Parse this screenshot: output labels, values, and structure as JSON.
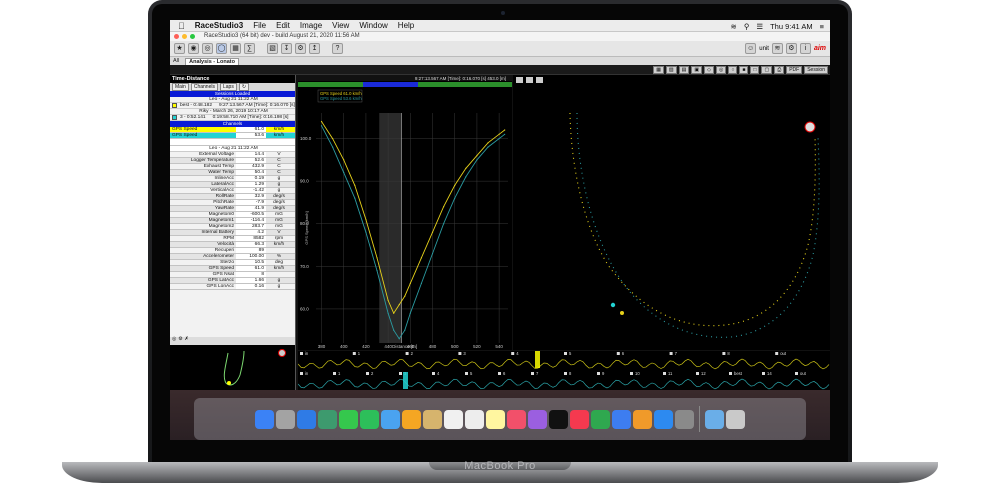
{
  "device": {
    "brand": "MacBook Pro"
  },
  "menubar": {
    "apple": "",
    "items": [
      "RaceStudio3",
      "File",
      "Edit",
      "Image",
      "View",
      "Window",
      "Help"
    ],
    "clock": "Thu 9:41 AM"
  },
  "titlebar": {
    "text": "RaceStudio3 (64 bit) dev - build August 21, 2020 11:56 AM"
  },
  "toolbar": {
    "unit_label": "unit"
  },
  "tabs": {
    "all": "All",
    "analysis": "Analysis - Lonato"
  },
  "viewbar": {
    "pdf": "PDF",
    "session": "Session"
  },
  "left_panel": {
    "title": "Time-Distance",
    "tabs": [
      "Main",
      "Channels",
      "Laps"
    ],
    "sessions_header": "Sessions Loaded",
    "sessions": [
      {
        "label": "Leo - Aug 21 11:22 AM",
        "color": "#ffffff"
      },
      {
        "label": "best - 0:48.182",
        "time": "9:27:13.567 AM [Time]: 0:16.070 [s]",
        "color": "#ffff00"
      },
      {
        "label": "Riky - March 26, 2019 10:17 AM",
        "color": "#ffffff"
      },
      {
        "label": "3 - 0:52.141",
        "time": "0:19:58.710 AM [Time]: 0:16.198 [s]",
        "color": "#22d3d3"
      }
    ],
    "channels_header": "Channels",
    "channels": [
      {
        "name": "GPS Speed",
        "value": "61.0",
        "unit": "km/h",
        "color": "#ffff00"
      },
      {
        "name": "GPS Speed",
        "value": "53.6",
        "unit": "km/h",
        "color": "#22d3d3"
      }
    ],
    "detail_title": "Leo - Aug 21 11:22 AM",
    "rows": [
      {
        "n": "External Voltage",
        "v": "14.4",
        "u": "V"
      },
      {
        "n": "Logger Temperature",
        "v": "52.6",
        "u": "C"
      },
      {
        "n": "Exhaust Temp",
        "v": "432.9",
        "u": "C"
      },
      {
        "n": "Water Temp",
        "v": "50.4",
        "u": "C"
      },
      {
        "n": "InlineAcc",
        "v": "0.19",
        "u": "g"
      },
      {
        "n": "LateralAcc",
        "v": "1.29",
        "u": "g"
      },
      {
        "n": "VerticalAcc",
        "v": "-1.42",
        "u": "g"
      },
      {
        "n": "RollRate",
        "v": "32.9",
        "u": "deg/s"
      },
      {
        "n": "PitchRate",
        "v": "-7.9",
        "u": "deg/s"
      },
      {
        "n": "YawRate",
        "v": "41.9",
        "u": "deg/s"
      },
      {
        "n": "Magnetom0",
        "v": "-600.5",
        "u": "mG"
      },
      {
        "n": "Magnetom1",
        "v": "-116.4",
        "u": "mG"
      },
      {
        "n": "Magnetom2",
        "v": "283.7",
        "u": "mG"
      },
      {
        "n": "Internal Battery",
        "v": "4.2",
        "u": "V"
      },
      {
        "n": "RPM",
        "v": "8582",
        "u": "rpm"
      },
      {
        "n": "Velocità",
        "v": "66.3",
        "u": "km/h"
      },
      {
        "n": "Recuperi",
        "v": "89",
        "u": ""
      },
      {
        "n": "Accelerometer",
        "v": "100.00",
        "u": "%"
      },
      {
        "n": "Sterzo",
        "v": "10.5",
        "u": "deg"
      },
      {
        "n": "GPS Speed",
        "v": "61.0",
        "u": "km/h"
      },
      {
        "n": "GPS Nsat",
        "v": "8",
        "u": ""
      },
      {
        "n": "GPS LatAcc",
        "v": "1.66",
        "u": "g"
      },
      {
        "n": "GPS LonAcc",
        "v": "0.16",
        "u": "g"
      }
    ]
  },
  "chart_data": {
    "type": "line",
    "title": "",
    "header": "9:27:13.567 AM [Time]: 0:16.070 [s]   453.0 [m]",
    "legend": [
      "GPS Speed  61.0 km/h",
      "GPS Speed  53.6 km/h"
    ],
    "xlabel": "Distance [m]",
    "ylabel": "GPS Speed [km/h]",
    "xlim": [
      375,
      548
    ],
    "ylim": [
      52,
      106
    ],
    "xticks": [
      380,
      400,
      420,
      440,
      460,
      480,
      500,
      520,
      540
    ],
    "yticks": [
      60,
      70,
      80,
      90,
      100
    ],
    "ytick_labels": [
      "60.0",
      "70.0",
      "80.0",
      "90.0",
      "100.0"
    ],
    "cursor_x": 452,
    "series": [
      {
        "name": "GPS Speed",
        "color": "#e6d11a",
        "x": [
          380,
          390,
          400,
          410,
          420,
          430,
          440,
          445,
          450,
          455,
          460,
          470,
          480,
          490,
          500,
          510,
          520,
          530,
          540,
          545
        ],
        "y": [
          104,
          100,
          95,
          89,
          81,
          72,
          62,
          59,
          61,
          63,
          66,
          72,
          78,
          84,
          89,
          93,
          96,
          99,
          101,
          102
        ]
      },
      {
        "name": "GPS Speed",
        "color": "#2a9aa0",
        "x": [
          380,
          390,
          400,
          410,
          420,
          430,
          440,
          445,
          450,
          455,
          460,
          470,
          480,
          490,
          500,
          510,
          520,
          530,
          540,
          545
        ],
        "y": [
          103,
          98,
          92,
          86,
          78,
          69,
          59,
          55,
          53,
          55,
          59,
          66,
          73,
          80,
          86,
          91,
          95,
          98,
          100,
          101
        ]
      }
    ]
  },
  "laps": {
    "row1": [
      "in",
      "1",
      "2",
      "3",
      "4",
      "5",
      "6",
      "7",
      "8",
      "out"
    ],
    "row2": [
      "in",
      "1",
      "2",
      "3",
      "4",
      "5",
      "6",
      "7",
      "8",
      "9",
      "10",
      "11",
      "12",
      "best",
      "14",
      "out"
    ]
  },
  "dock": {
    "icons": [
      "Finder",
      "Launchpad",
      "Safari",
      "Photo",
      "Messages",
      "FaceTime",
      "Mail",
      "Photos",
      "Notes",
      "Calendar",
      "Reminders",
      "Notes2",
      "Music",
      "Podcasts",
      "TV",
      "News",
      "Numbers",
      "Keynote",
      "Pages",
      "App Store",
      "System Preferences",
      "Folder",
      "Trash"
    ]
  }
}
